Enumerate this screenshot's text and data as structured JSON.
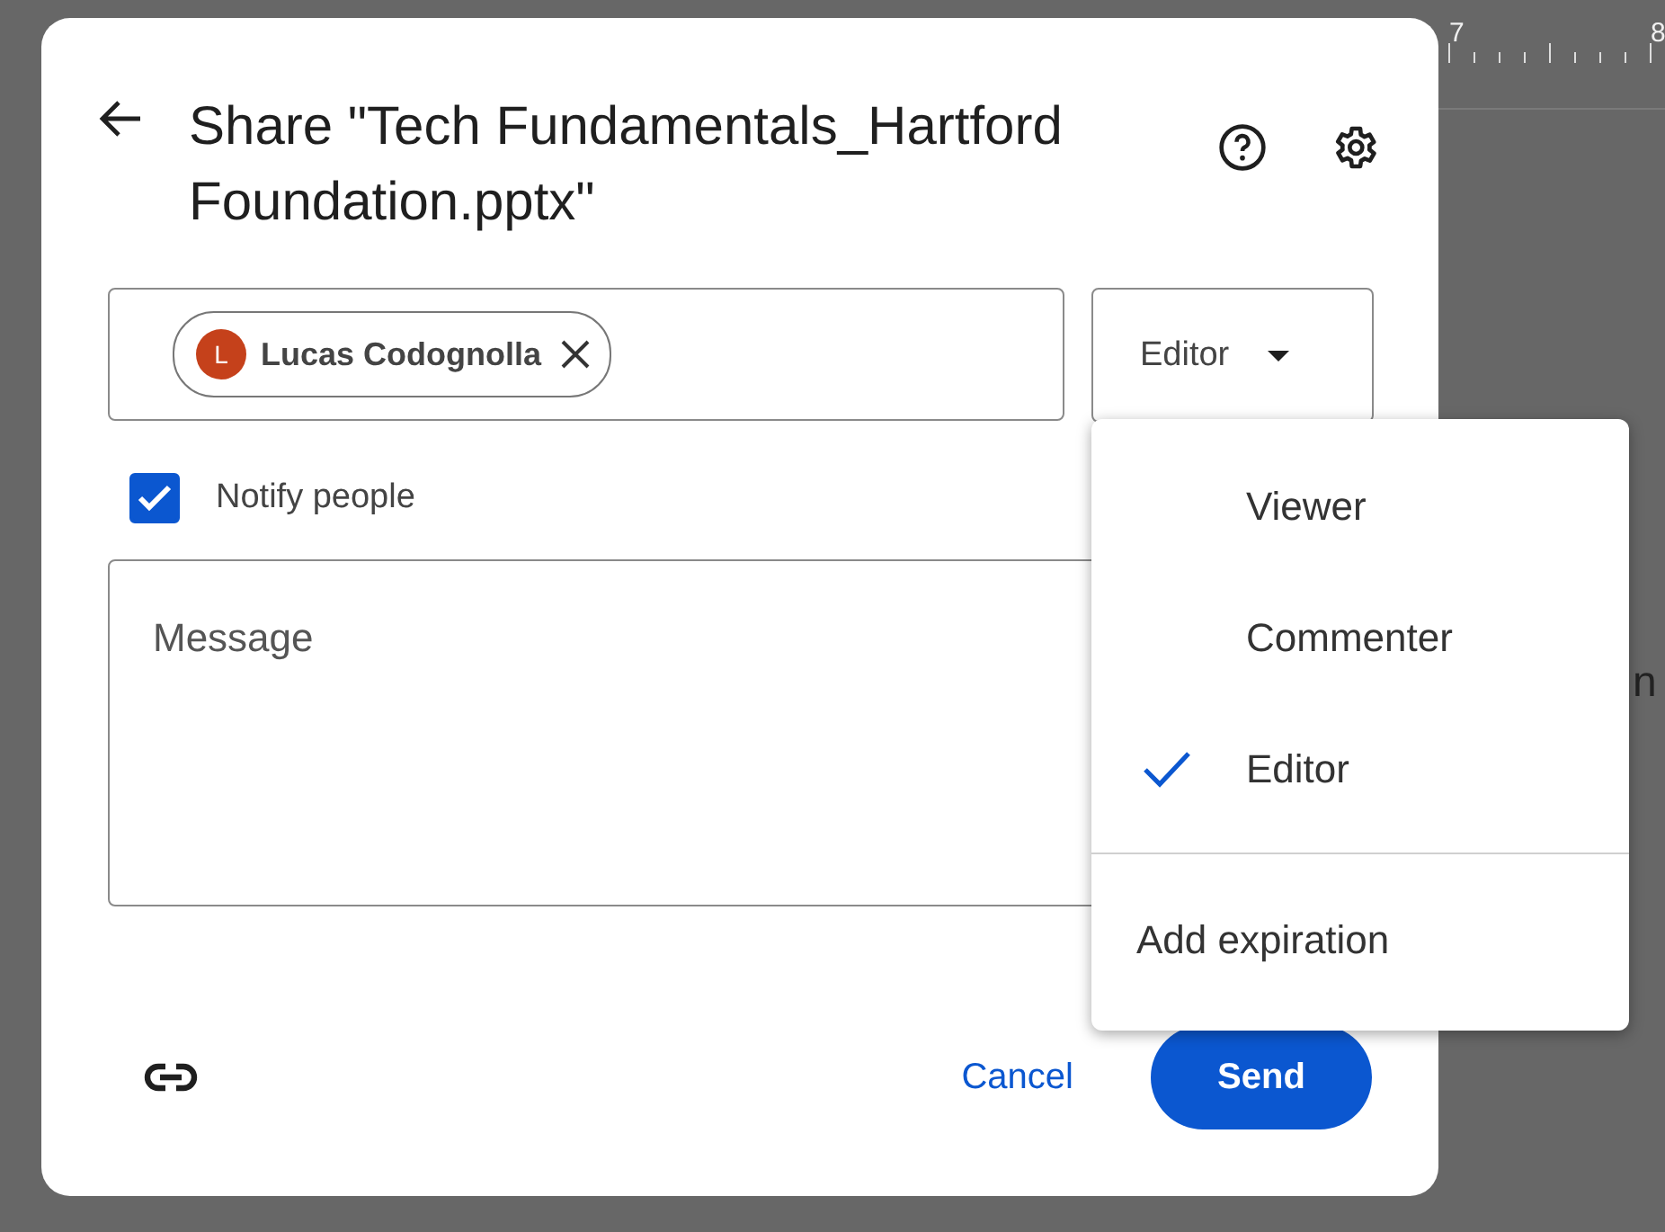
{
  "background": {
    "ruler_labels": [
      "7",
      "8"
    ],
    "page_text": "n"
  },
  "dialog": {
    "title": "Share \"Tech Fundamentals_Hartford Foundation.pptx\"",
    "recipients": [
      {
        "initial": "L",
        "name": "Lucas Codognolla",
        "color": "#c5411b"
      }
    ],
    "role": "Editor",
    "notify": {
      "label": "Notify people",
      "checked": true
    },
    "message": {
      "placeholder": "Message"
    },
    "buttons": {
      "cancel": "Cancel",
      "send": "Send"
    }
  },
  "role_menu": {
    "items": [
      {
        "label": "Viewer",
        "selected": false
      },
      {
        "label": "Commenter",
        "selected": false
      },
      {
        "label": "Editor",
        "selected": true
      }
    ],
    "extra": "Add expiration"
  }
}
